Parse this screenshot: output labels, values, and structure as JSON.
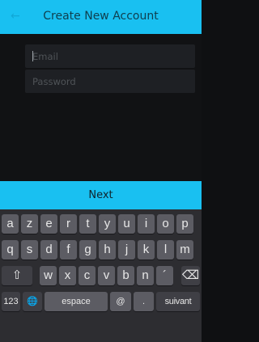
{
  "header": {
    "back_icon": "arrow-left-icon",
    "back_glyph": "←",
    "title": "Create New Account"
  },
  "form": {
    "email_placeholder": "Email",
    "password_placeholder": "Password"
  },
  "next_label": "Next",
  "keyboard": {
    "row1": [
      "a",
      "z",
      "e",
      "r",
      "t",
      "y",
      "u",
      "i",
      "o",
      "p"
    ],
    "row2": [
      "q",
      "s",
      "d",
      "f",
      "g",
      "h",
      "j",
      "k",
      "l",
      "m"
    ],
    "row3": [
      "w",
      "x",
      "c",
      "v",
      "b",
      "n",
      "´"
    ],
    "shift_icon": "shift-icon",
    "shift_glyph": "⇧",
    "backspace_icon": "backspace-icon",
    "backspace_glyph": "⌫",
    "numbers_label": "123",
    "globe_icon": "globe-icon",
    "globe_glyph": "🌐",
    "space_label": "espace",
    "at_label": "@",
    "dot_label": ".",
    "next_label": "suivant"
  },
  "colors": {
    "accent": "#19c0f1",
    "background": "#0f1012",
    "keyboard_bg": "#2d2d31",
    "key_bg": "#5c5c63"
  }
}
